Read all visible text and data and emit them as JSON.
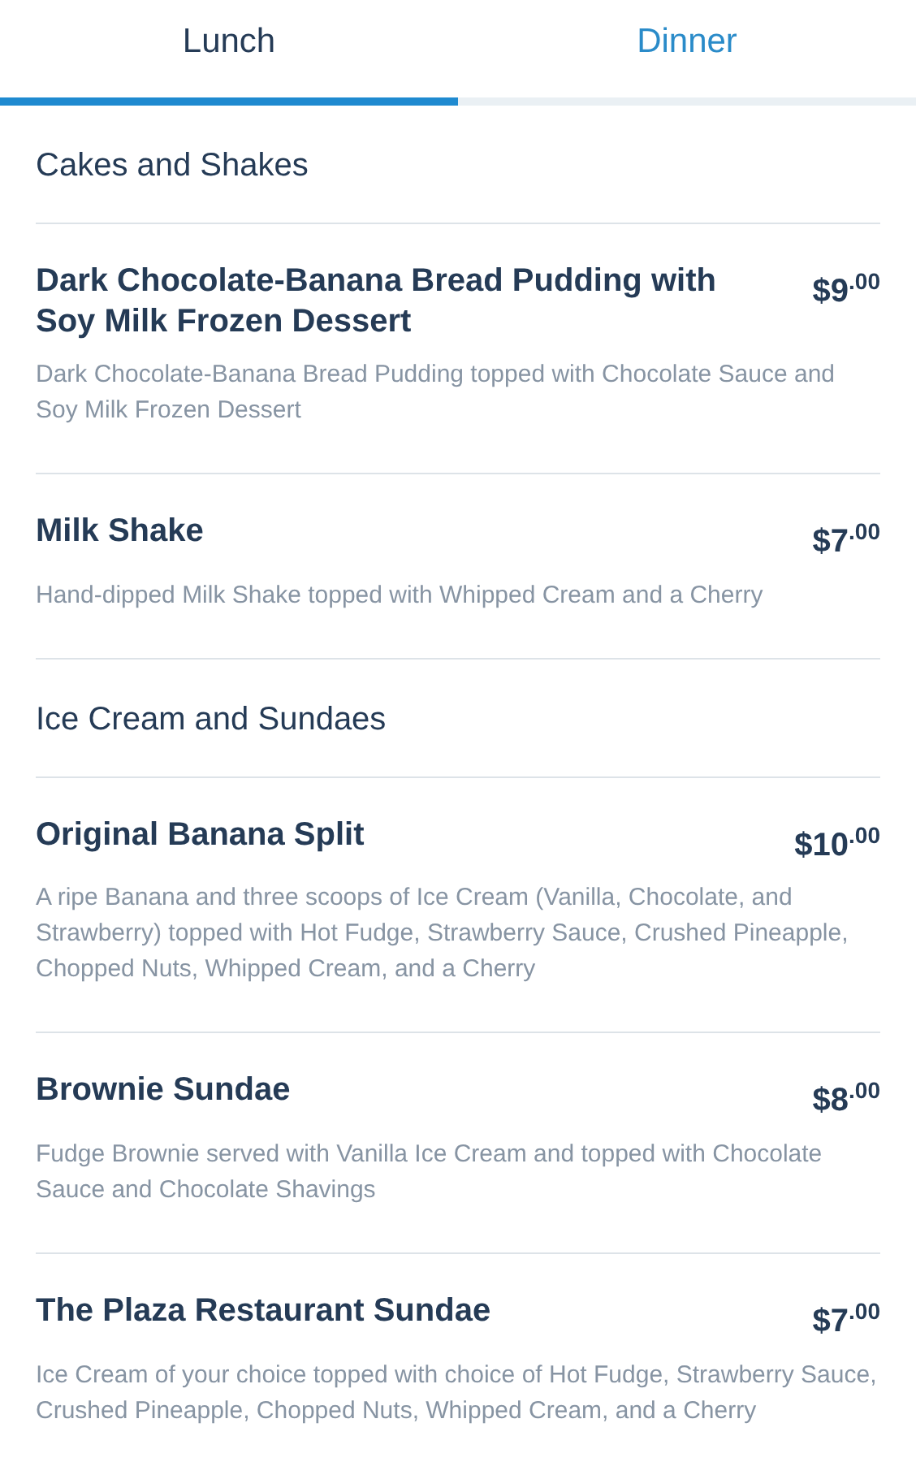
{
  "tabs": [
    {
      "label": "Lunch",
      "selected": true
    },
    {
      "label": "Dinner",
      "selected": false
    }
  ],
  "sections": [
    {
      "title": "Cakes and Shakes",
      "items": [
        {
          "name": "Dark Chocolate-Banana Bread Pudding with Soy Milk Frozen Dessert",
          "price": "$9$^{.00}$",
          "description": "Dark Chocolate-Banana Bread Pudding topped with Chocolate Sauce and Soy Milk Frozen Dessert"
        },
        {
          "name": "Milk Shake",
          "price": "$7$^{.00}$",
          "description": "Hand-dipped Milk Shake topped with Whipped Cream and a Cherry"
        }
      ]
    },
    {
      "title": "Ice Cream and Sundaes",
      "items": [
        {
          "name": "Original Banana Split",
          "price": "$10$^{.00}$",
          "description": "A ripe Banana and three scoops of Ice Cream (Vanilla, Chocolate, and Strawberry) topped with Hot Fudge, Strawberry Sauce, Crushed Pineapple, Chopped Nuts, Whipped Cream, and a Cherry"
        },
        {
          "name": "Brownie Sundae",
          "price": "$8$^{.00}$",
          "description": "Fudge Brownie served with Vanilla Ice Cream and topped with Chocolate Sauce and Chocolate Shavings"
        },
        {
          "name": "The Plaza Restaurant Sundae",
          "price": "$7$^{.00}$",
          "description": "Ice Cream of your choice topped with choice of Hot Fudge, Strawberry Sauce, Crushed Pineapple, Chopped Nuts, Whipped Cream, and a Cherry"
        }
      ]
    }
  ]
}
